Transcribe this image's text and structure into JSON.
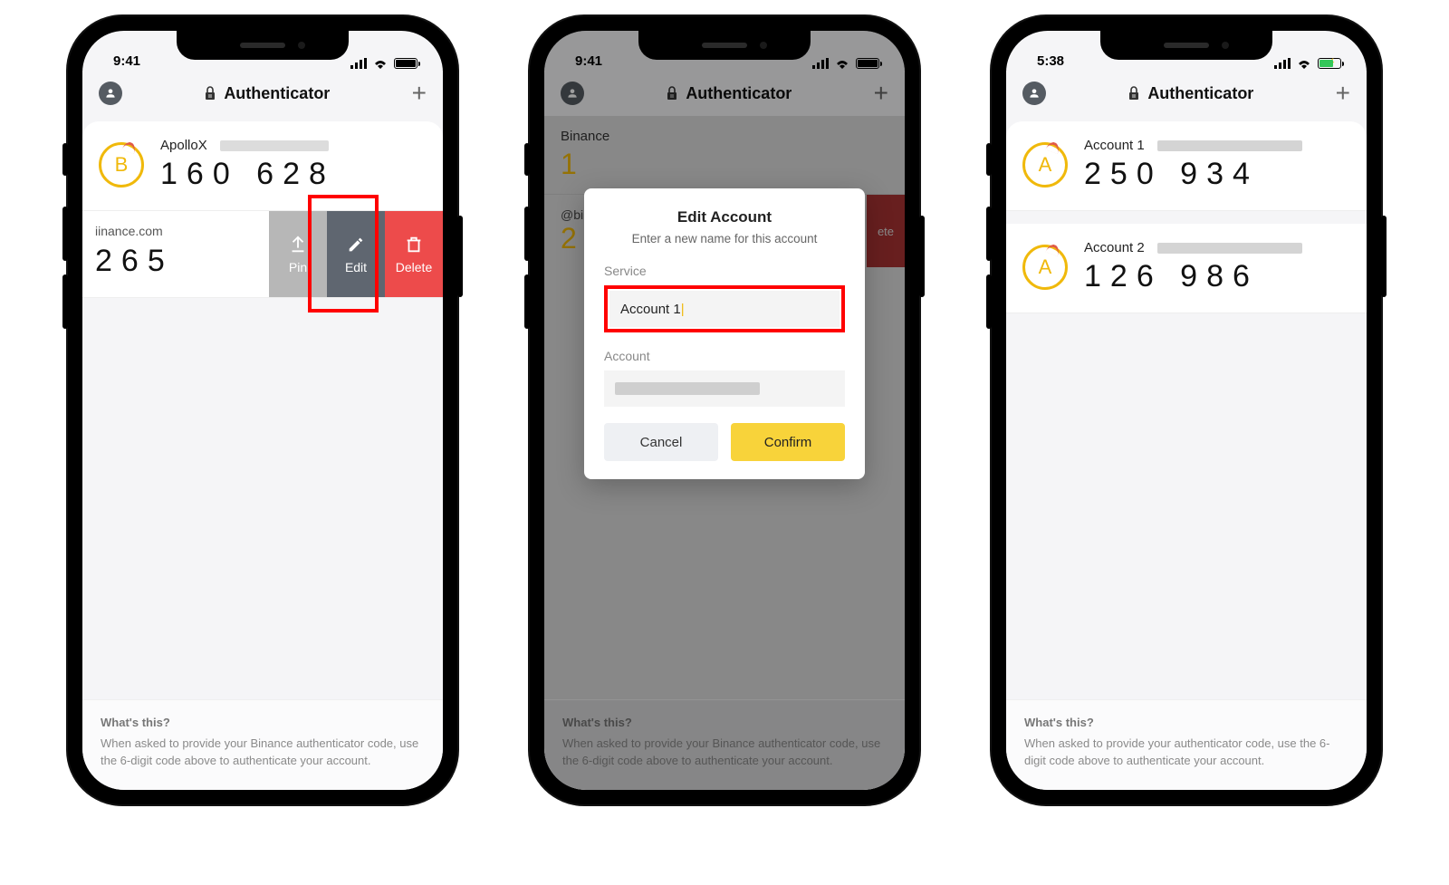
{
  "common": {
    "app_title": "Authenticator",
    "footer_title": "What's this?"
  },
  "phone1": {
    "time": "9:41",
    "entry1": {
      "letter": "B",
      "name": "ApolloX",
      "code": "160 628"
    },
    "swipe": {
      "sub": "iinance.com",
      "partial_code": "265",
      "pin": "Pin",
      "edit": "Edit",
      "del": "Delete"
    },
    "footer_body": "When asked to provide your Binance authenticator code, use the 6-digit code above to authenticate your account."
  },
  "phone2": {
    "time": "9:41",
    "bg_entry": {
      "name": "Binance",
      "code": "1"
    },
    "bg_swipe": {
      "label": "@bina",
      "code": "2",
      "del": "ete"
    },
    "modal": {
      "title": "Edit Account",
      "subtitle": "Enter a new name for this account",
      "service_label": "Service",
      "service_value": "Account 1",
      "account_label": "Account",
      "cancel": "Cancel",
      "confirm": "Confirm"
    },
    "footer_body": "When asked to provide your Binance authenticator code, use the 6-digit code above to authenticate your account."
  },
  "phone3": {
    "time": "5:38",
    "entry1": {
      "letter": "A",
      "name": "Account 1",
      "code": "250 934"
    },
    "entry2": {
      "letter": "A",
      "name": "Account 2",
      "code": "126 986"
    },
    "footer_body": "When asked to provide your authenticator code, use the 6-digit code above to authenticate your account."
  }
}
